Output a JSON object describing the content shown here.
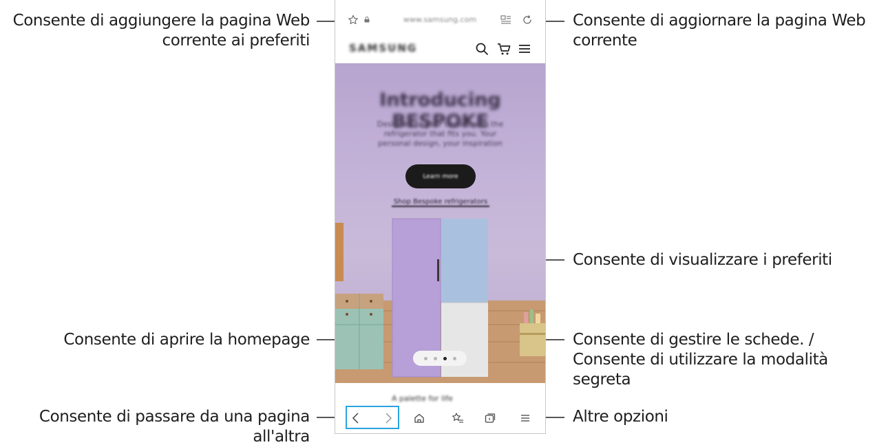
{
  "browser": {
    "url": "www.samsung.com",
    "brand": "SAMSUNG"
  },
  "hero": {
    "title": "Introducing BESPOKE",
    "subtitle": "Designed to your tastes, with the refrigerator that fits you. Your personal design, your inspiration",
    "cta_label": "Learn more",
    "link_label": "Shop Bespoke refrigerators"
  },
  "carousel": {
    "count": 4,
    "active_index": 2
  },
  "content_strip": {
    "text": "A palette for life"
  },
  "callouts": {
    "bookmark_add": "Consente di aggiungere la pagina Web corrente ai preferiti",
    "reload": "Consente di aggiornare la pagina Web corrente",
    "view_bookmarks": "Consente di visualizzare i preferiti",
    "homepage": "Consente di aprire la homepage",
    "tabs_line1": "Consente di gestire le schede. /",
    "tabs_line2": "Consente di utilizzare la modalità segreta",
    "navigate": "Consente di passare da una pagina all'altra",
    "more_options": "Altre opzioni"
  },
  "colors": {
    "accent": "#29a3df",
    "hero_background": "#c4b3d8",
    "cta_background": "#1b1b1b"
  },
  "icons": [
    "star-icon",
    "lock-icon",
    "reader-mode-icon",
    "refresh-icon",
    "search-icon",
    "cart-icon",
    "menu-icon",
    "back-icon",
    "forward-icon",
    "home-icon",
    "bookmarks-icon",
    "tabs-icon",
    "more-options-icon"
  ]
}
